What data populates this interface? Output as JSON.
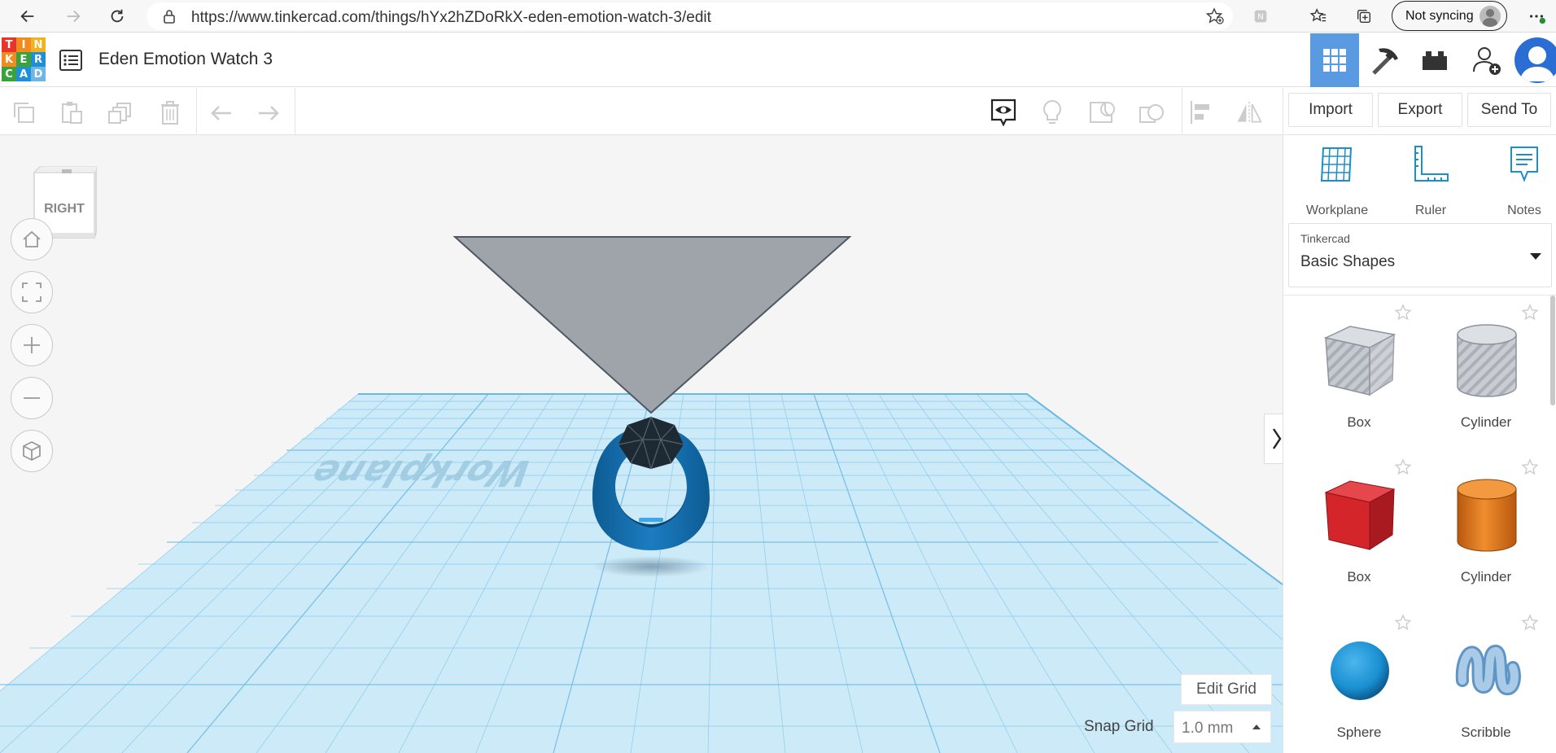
{
  "browser": {
    "url": "https://www.tinkercad.com/things/hYx2hZDoRkX-eden-emotion-watch-3/edit",
    "sync_label": "Not syncing"
  },
  "header": {
    "logo_letters": [
      "T",
      "I",
      "N",
      "K",
      "E",
      "R",
      "C",
      "A",
      "D"
    ],
    "project_title": "Eden Emotion Watch 3"
  },
  "toolbar": {
    "import_label": "Import",
    "export_label": "Export",
    "send_to_label": "Send To"
  },
  "viewport": {
    "view_cube_face": "RIGHT",
    "workplane_watermark": "Workplane",
    "edit_grid_label": "Edit Grid",
    "snap_grid_label": "Snap Grid",
    "snap_grid_value": "1.0 mm"
  },
  "panel": {
    "tools": [
      {
        "label": "Workplane",
        "icon": "workplane-icon"
      },
      {
        "label": "Ruler",
        "icon": "ruler-icon"
      },
      {
        "label": "Notes",
        "icon": "notes-icon"
      }
    ],
    "library_source": "Tinkercad",
    "library_name": "Basic Shapes",
    "shapes": [
      {
        "name": "Box",
        "style": "hole",
        "color": "#b8bcc4"
      },
      {
        "name": "Cylinder",
        "style": "hole",
        "color": "#b8bcc4"
      },
      {
        "name": "Box",
        "style": "solid",
        "color": "#d4252a"
      },
      {
        "name": "Cylinder",
        "style": "solid",
        "color": "#e07a1f"
      },
      {
        "name": "Sphere",
        "style": "solid",
        "color": "#1a8fd1"
      },
      {
        "name": "Scribble",
        "style": "solid",
        "color": "#8cb8dc"
      }
    ]
  },
  "colors": {
    "accent": "#5a9ae0",
    "grid": "#b9e0f3",
    "ring": "#1b6ea8"
  }
}
